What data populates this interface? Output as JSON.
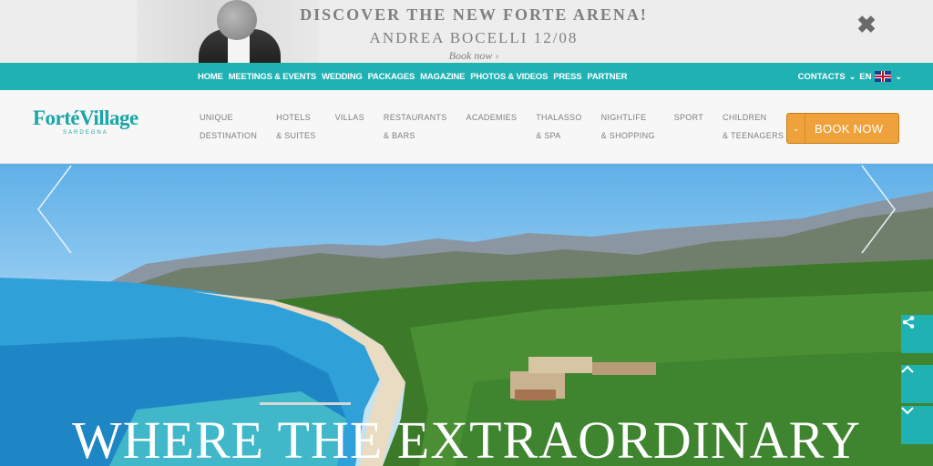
{
  "promo": {
    "line1": "DISCOVER THE NEW FORTE ARENA!",
    "line2": "ANDREA BOCELLI  12/08",
    "cta": "Book now ›",
    "close_glyph": "✖"
  },
  "topnav": {
    "items": [
      "HOME",
      "MEETINGS & EVENTS",
      "WEDDING",
      "PACKAGES",
      "MAGAZINE",
      "PHOTOS & VIDEOS",
      "PRESS",
      "PARTNER"
    ],
    "contacts": "CONTACTS",
    "language": "EN",
    "accent_color": "#20b2b3"
  },
  "header": {
    "logo": "FortéVillage",
    "logo_sub": "SARDEGNA",
    "nav": [
      {
        "line1": "UNIQUE",
        "line2": "DESTINATION"
      },
      {
        "line1": "HOTELS",
        "line2": "& SUITES"
      },
      {
        "line1": "VILLAS",
        "line2": ""
      },
      {
        "line1": "RESTAURANTS",
        "line2": "& BARS"
      },
      {
        "line1": "ACADEMIES",
        "line2": ""
      },
      {
        "line1": "THALASSO",
        "line2": "& SPA"
      },
      {
        "line1": "NIGHTLIFE",
        "line2": "& SHOPPING"
      },
      {
        "line1": "SPORT",
        "line2": ""
      },
      {
        "line1": "CHILDREN",
        "line2": "& TEENAGERS"
      }
    ],
    "book_now": "BOOK NOW",
    "book_color": "#efa23b"
  },
  "hero": {
    "headline": "WHERE THE EXTRAORDINARY",
    "side_buttons": [
      "share-icon",
      "chevron-up-icon",
      "chevron-down-icon"
    ]
  }
}
